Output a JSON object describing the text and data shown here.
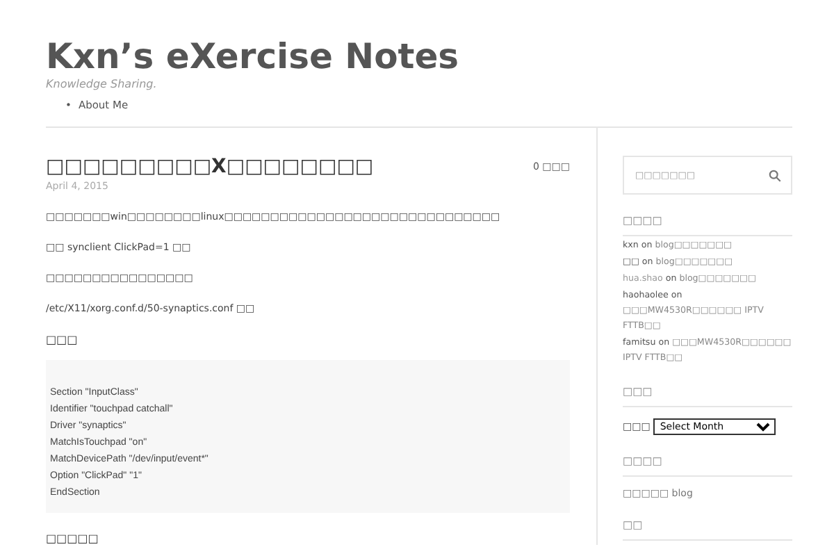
{
  "site": {
    "title": "Kxn’s eXercise Notes",
    "tagline": "Knowledge Sharing.",
    "nav": [
      {
        "marker": "•",
        "label": "About Me"
      }
    ]
  },
  "post": {
    "title": "□□□□□□□□□X□□□□□□□□",
    "comments": "0 □□□",
    "date": "April 4, 2015",
    "blocks": [
      {
        "kind": "text",
        "text": "□□□□□□□win□□□□□□□□linux□□□□□□□□□□□□□□□□□□□□□□□□□□□□□□"
      },
      {
        "kind": "text",
        "text": "□□ synclient ClickPad=1 □□"
      },
      {
        "kind": "text",
        "text": "□□□□□□□□□□□□□□□□"
      },
      {
        "kind": "text",
        "text": "/etc/X11/xorg.conf.d/50-synaptics.conf □□"
      },
      {
        "kind": "heading",
        "text": "□□□"
      },
      {
        "kind": "code",
        "lines": [
          "Section \"InputClass\"",
          "Identifier \"touchpad catchall\"",
          "Driver \"synaptics\"",
          "MatchIsTouchpad \"on\"",
          "MatchDevicePath \"/dev/input/event*\"",
          "Option \"ClickPad\" \"1\"",
          "EndSection"
        ]
      },
      {
        "kind": "heading",
        "text": "□□□□□"
      }
    ]
  },
  "sidebar": {
    "search": {
      "placeholder": "□□□□□□□"
    },
    "recent_comments": {
      "title": "□□□□",
      "items": [
        {
          "author": "kxn",
          "linked": false,
          "on": "on",
          "post": "blog□□□□□□□"
        },
        {
          "author": "□□",
          "linked": false,
          "on": "on",
          "post": "blog□□□□□□□"
        },
        {
          "author": "hua.shao",
          "linked": true,
          "on": "on",
          "post": "blog□□□□□□□"
        },
        {
          "author": "haohaolee",
          "linked": false,
          "on": "on",
          "post": "□□□MW4530R□□□□□□ IPTV FTTB□□"
        },
        {
          "author": "famitsu",
          "linked": false,
          "on": "on",
          "post": "□□□MW4530R□□□□□□ IPTV FTTB□□"
        }
      ]
    },
    "archives": {
      "title": "□□□",
      "label": "□□□",
      "select": "Select Month"
    },
    "categories": {
      "title": "□□□□",
      "items": [
        "□□□□□ blog"
      ]
    },
    "meta": {
      "title": "□□"
    }
  }
}
